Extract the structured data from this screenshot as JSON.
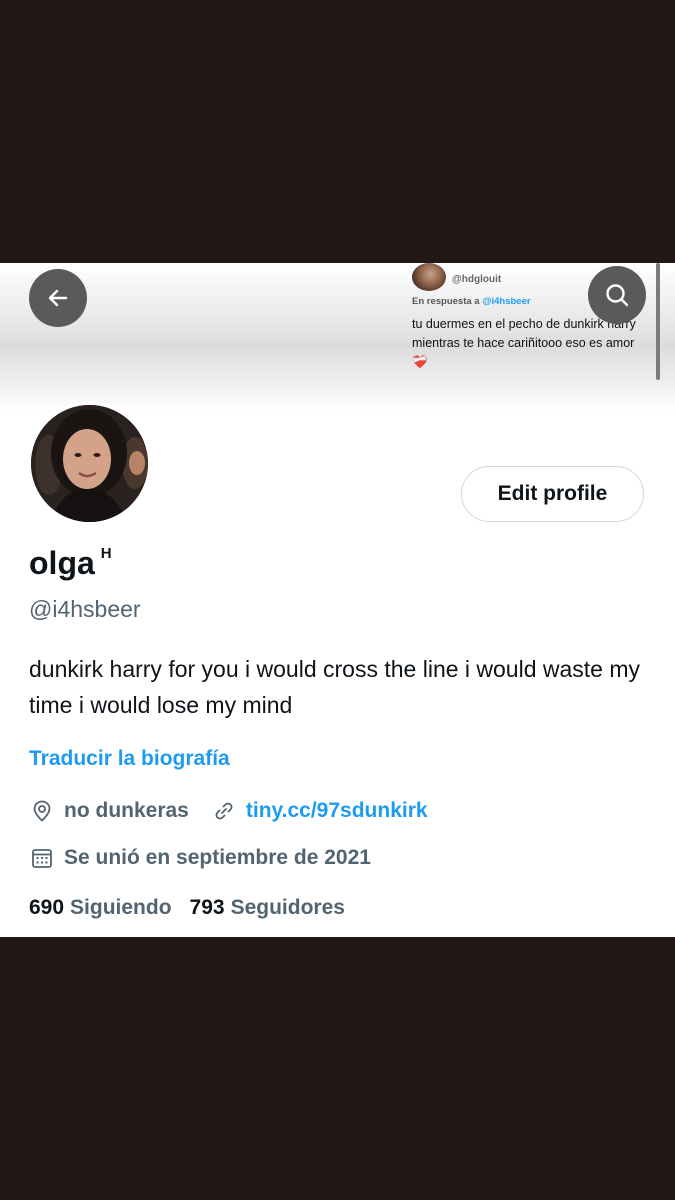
{
  "header": {
    "back_icon": "arrow-left-icon",
    "search_icon": "search-icon"
  },
  "tweet_preview": {
    "handle": "@hdglouit",
    "reply_prefix": "En respuesta a",
    "reply_mention": "@i4hsbeer",
    "text": "tu duermes en el pecho de dunkirk harry mientras te hace cariñitooo eso es amor",
    "emoji": "❤️‍🩹"
  },
  "profile": {
    "name": "olga",
    "name_sup": "H",
    "handle": "@i4hsbeer",
    "bio": "dunkirk harry for you i would cross the line i would waste my time i would lose my mind",
    "translate_label": "Traducir la biografía",
    "location": "no dunkeras",
    "url": "tiny.cc/97sdunkirk",
    "joined": "Se unió en septiembre de 2021",
    "edit_label": "Edit profile"
  },
  "stats": {
    "following_count": "690",
    "following_label": "Siguiendo",
    "followers_count": "793",
    "followers_label": "Seguidores"
  },
  "colors": {
    "accent": "#1d9bf0",
    "secondary_text": "#536471",
    "background_frame": "#231815"
  }
}
